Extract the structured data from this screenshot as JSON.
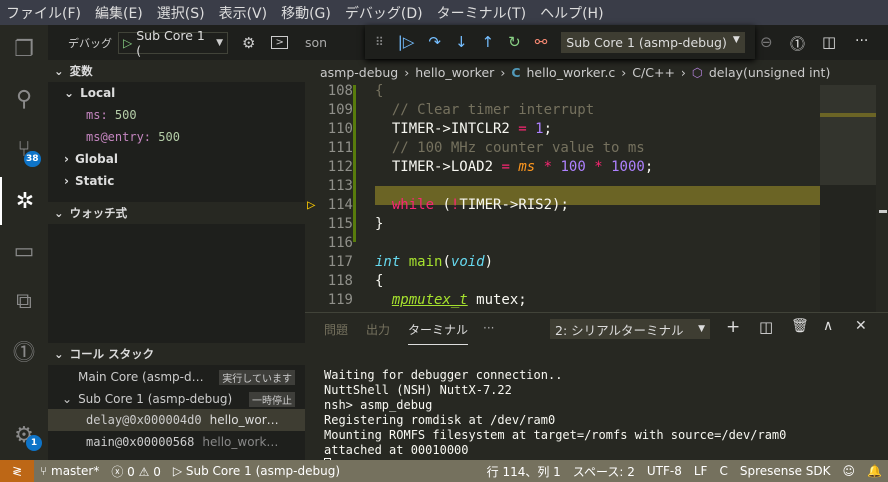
{
  "menu": [
    "ファイル(F)",
    "編集(E)",
    "選択(S)",
    "表示(V)",
    "移動(G)",
    "デバッグ(D)",
    "ターミナル(T)",
    "ヘルプ(H)"
  ],
  "activity": {
    "scm_badge": "38",
    "settings_badge": "1"
  },
  "sidebar": {
    "debug_label": "デバッグ",
    "config": "Sub Core 1 (",
    "variables": "変数",
    "local": "Local",
    "vars": [
      {
        "name": "ms:",
        "value": "500"
      },
      {
        "name": "ms@entry:",
        "value": "500"
      }
    ],
    "global": "Global",
    "static": "Static",
    "watch": "ウォッチ式",
    "callstack": "コール スタック",
    "threads": [
      {
        "name": "Main Core (asmp-d…",
        "state": "実行しています"
      },
      {
        "name": "Sub Core 1 (asmp-debug)",
        "state": "一時停止"
      }
    ],
    "frames": [
      {
        "name": "delay@0x000004d0",
        "file": "hello_wor…"
      },
      {
        "name": "main@0x00000568",
        "file": "hello_work…"
      }
    ]
  },
  "tab": {
    "partial": "son"
  },
  "debug_toolbar": {
    "config": "Sub Core 1 (asmp-debug)"
  },
  "breadcrumb": [
    "asmp-debug",
    "hello_worker",
    "hello_worker.c",
    "C/C++",
    "delay(unsigned int)"
  ],
  "code": {
    "lines": [
      "108",
      "109",
      "110",
      "111",
      "112",
      "113",
      "114",
      "115",
      "116",
      "117",
      "118",
      "119"
    ]
  },
  "panel": {
    "tabs": [
      "問題",
      "出力",
      "ターミナル",
      "···"
    ],
    "terminal_select": "2: シリアルターミナル",
    "output": [
      "Waiting for debugger connection..",
      "NuttShell (NSH) NuttX-7.22",
      "nsh> asmp_debug",
      "Registering romdisk at /dev/ram0",
      "Mounting ROMFS filesystem at target=/romfs with source=/dev/ram0",
      "attached at 00010000"
    ]
  },
  "status": {
    "branch": "master*",
    "errors": "0",
    "warnings": "0",
    "debug": "Sub Core 1 (asmp-debug)",
    "position": "行 114、列 1",
    "spaces": "スペース: 2",
    "encoding": "UTF-8",
    "eol": "LF",
    "language": "C",
    "sdk": "Spresense SDK"
  },
  "colors": {
    "status_bar": "#75715e",
    "debug_item": "#bd6716",
    "current_line": "#6b6425",
    "editor_bg": "#272822"
  }
}
